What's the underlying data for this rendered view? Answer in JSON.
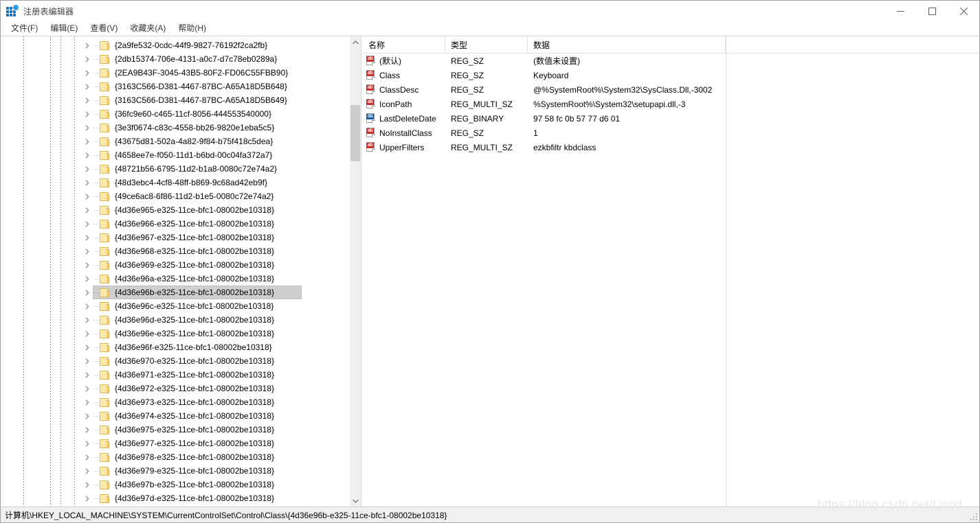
{
  "window": {
    "title": "注册表编辑器",
    "app_icon": "registry-grid-icon",
    "controls": {
      "minimize": "最小化",
      "maximize": "最大化",
      "close": "关闭"
    }
  },
  "menubar": {
    "items": [
      {
        "label": "文件(F)"
      },
      {
        "label": "编辑(E)"
      },
      {
        "label": "查看(V)"
      },
      {
        "label": "收藏夹(A)"
      },
      {
        "label": "帮助(H)"
      }
    ]
  },
  "tree": {
    "selected_key": "{4d36e96b-e325-11ce-bfc1-08002be10318}",
    "items": [
      {
        "label": "{2a9fe532-0cdc-44f9-9827-76192f2ca2fb}",
        "selected": false
      },
      {
        "label": "{2db15374-706e-4131-a0c7-d7c78eb0289a}",
        "selected": false
      },
      {
        "label": "{2EA9B43F-3045-43B5-80F2-FD06C55FBB90}",
        "selected": false
      },
      {
        "label": "{3163C566-D381-4467-87BC-A65A18D5B648}",
        "selected": false
      },
      {
        "label": "{3163C566-D381-4467-87BC-A65A18D5B649}",
        "selected": false
      },
      {
        "label": "{36fc9e60-c465-11cf-8056-444553540000}",
        "selected": false
      },
      {
        "label": "{3e3f0674-c83c-4558-bb26-9820e1eba5c5}",
        "selected": false
      },
      {
        "label": "{43675d81-502a-4a82-9f84-b75f418c5dea}",
        "selected": false
      },
      {
        "label": "{4658ee7e-f050-11d1-b6bd-00c04fa372a7}",
        "selected": false
      },
      {
        "label": "{48721b56-6795-11d2-b1a8-0080c72e74a2}",
        "selected": false
      },
      {
        "label": "{48d3ebc4-4cf8-48ff-b869-9c68ad42eb9f}",
        "selected": false
      },
      {
        "label": "{49ce6ac8-6f86-11d2-b1e5-0080c72e74a2}",
        "selected": false
      },
      {
        "label": "{4d36e965-e325-11ce-bfc1-08002be10318}",
        "selected": false
      },
      {
        "label": "{4d36e966-e325-11ce-bfc1-08002be10318}",
        "selected": false
      },
      {
        "label": "{4d36e967-e325-11ce-bfc1-08002be10318}",
        "selected": false
      },
      {
        "label": "{4d36e968-e325-11ce-bfc1-08002be10318}",
        "selected": false
      },
      {
        "label": "{4d36e969-e325-11ce-bfc1-08002be10318}",
        "selected": false
      },
      {
        "label": "{4d36e96a-e325-11ce-bfc1-08002be10318}",
        "selected": false
      },
      {
        "label": "{4d36e96b-e325-11ce-bfc1-08002be10318}",
        "selected": true
      },
      {
        "label": "{4d36e96c-e325-11ce-bfc1-08002be10318}",
        "selected": false
      },
      {
        "label": "{4d36e96d-e325-11ce-bfc1-08002be10318}",
        "selected": false
      },
      {
        "label": "{4d36e96e-e325-11ce-bfc1-08002be10318}",
        "selected": false
      },
      {
        "label": "{4d36e96f-e325-11ce-bfc1-08002be10318}",
        "selected": false
      },
      {
        "label": "{4d36e970-e325-11ce-bfc1-08002be10318}",
        "selected": false
      },
      {
        "label": "{4d36e971-e325-11ce-bfc1-08002be10318}",
        "selected": false
      },
      {
        "label": "{4d36e972-e325-11ce-bfc1-08002be10318}",
        "selected": false
      },
      {
        "label": "{4d36e973-e325-11ce-bfc1-08002be10318}",
        "selected": false
      },
      {
        "label": "{4d36e974-e325-11ce-bfc1-08002be10318}",
        "selected": false
      },
      {
        "label": "{4d36e975-e325-11ce-bfc1-08002be10318}",
        "selected": false
      },
      {
        "label": "{4d36e977-e325-11ce-bfc1-08002be10318}",
        "selected": false
      },
      {
        "label": "{4d36e978-e325-11ce-bfc1-08002be10318}",
        "selected": false
      },
      {
        "label": "{4d36e979-e325-11ce-bfc1-08002be10318}",
        "selected": false
      },
      {
        "label": "{4d36e97b-e325-11ce-bfc1-08002be10318}",
        "selected": false
      },
      {
        "label": "{4d36e97d-e325-11ce-bfc1-08002be10318}",
        "selected": false
      }
    ]
  },
  "values": {
    "columns": {
      "name": "名称",
      "type": "类型",
      "data": "数据"
    },
    "rows": [
      {
        "icon": "string-value-icon",
        "name": "(默认)",
        "type": "REG_SZ",
        "data": "(数值未设置)"
      },
      {
        "icon": "string-value-icon",
        "name": "Class",
        "type": "REG_SZ",
        "data": "Keyboard"
      },
      {
        "icon": "string-value-icon",
        "name": "ClassDesc",
        "type": "REG_SZ",
        "data": "@%SystemRoot%\\System32\\SysClass.Dll,-3002"
      },
      {
        "icon": "string-value-icon",
        "name": "IconPath",
        "type": "REG_MULTI_SZ",
        "data": "%SystemRoot%\\System32\\setupapi.dll,-3"
      },
      {
        "icon": "binary-value-icon",
        "name": "LastDeleteDate",
        "type": "REG_BINARY",
        "data": "97 58 fc 0b 57 77 d6 01"
      },
      {
        "icon": "string-value-icon",
        "name": "NoInstallClass",
        "type": "REG_SZ",
        "data": "1"
      },
      {
        "icon": "string-value-icon",
        "name": "UpperFilters",
        "type": "REG_MULTI_SZ",
        "data": "ezkbfiltr kbdclass"
      }
    ]
  },
  "statusbar": {
    "path": "计算机\\HKEY_LOCAL_MACHINE\\SYSTEM\\CurrentControlSet\\Control\\Class\\{4d36e96b-e325-11ce-bfc1-08002be10318}"
  },
  "watermark": {
    "text": "https://blog.csdn.net/Ljnoit"
  },
  "colors": {
    "selection": "#cfcfcf",
    "folder": "#fde9a9",
    "folder_border": "#e3b94e",
    "value_string_icon": "#c9302c",
    "value_binary_icon": "#1f5fa8",
    "statusbar_bg": "#f0f0f0"
  }
}
